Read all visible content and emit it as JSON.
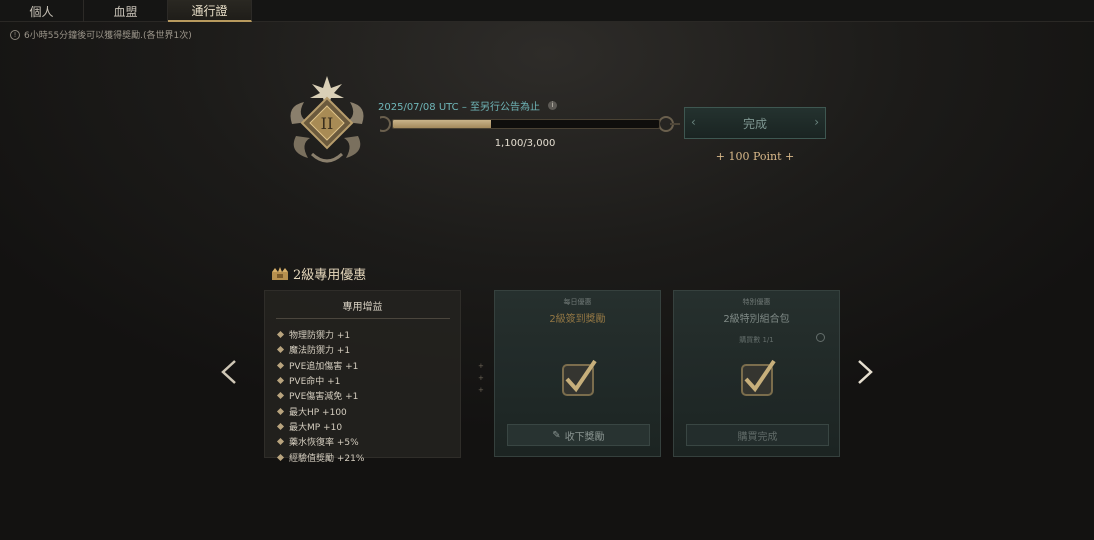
{
  "tabs": [
    {
      "label": "個人"
    },
    {
      "label": "血盟"
    },
    {
      "label": "通行證"
    }
  ],
  "notice": "6小時55分鐘後可以獲得獎勵.(各世界1次)",
  "level": {
    "roman": "II",
    "period": "2025/07/08 UTC – 至另行公告為止",
    "current": 1100,
    "max": 3000,
    "progress_text": "1,100/3,000",
    "complete_label": "完成",
    "points_label": "+ 100 Point +"
  },
  "section": {
    "title": "2級專用優惠",
    "perks_title": "專用增益",
    "perks": [
      "物理防禦力 +1",
      "魔法防禦力 +1",
      "PVE追加傷害 +1",
      "PVE命中 +1",
      "PVE傷害減免 +1",
      "最大HP +100",
      "最大MP +10",
      "藥水恢復率 +5%",
      "經驗值獎勵 +21%"
    ],
    "cards": [
      {
        "sub": "每日優惠",
        "title": "2級簽到獎勵",
        "button": "收下獎勵"
      },
      {
        "sub": "特別優惠",
        "title": "2級特別組合包",
        "count": "購買數 1/1",
        "button": "購買完成"
      }
    ]
  },
  "colors": {
    "accent": "#b89a5e",
    "teal": "#6fb6b8",
    "gold": "#d9b98a"
  }
}
